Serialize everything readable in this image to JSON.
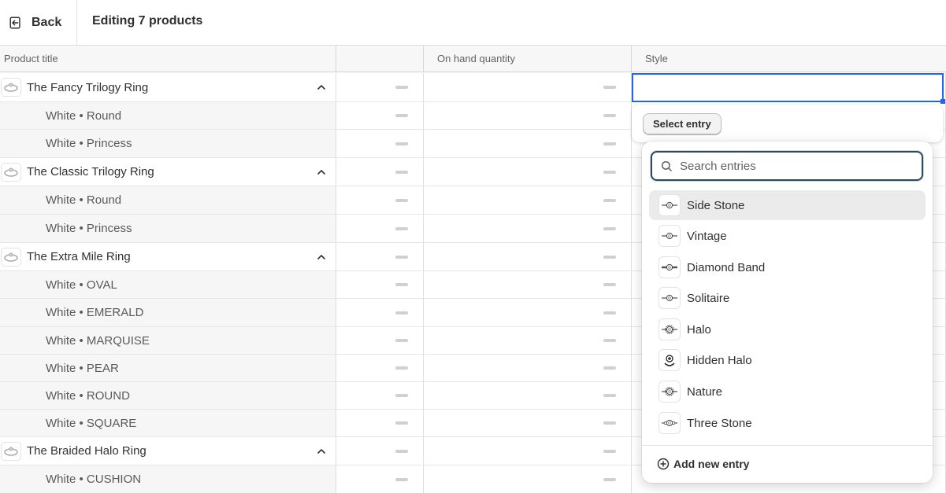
{
  "header": {
    "back_label": "Back",
    "title": "Editing 7 products"
  },
  "columns": [
    "Product title",
    "",
    "On hand quantity",
    "Style"
  ],
  "rows": [
    {
      "type": "product",
      "title": "The Fancy Trilogy Ring"
    },
    {
      "type": "variant",
      "title": "White • Round"
    },
    {
      "type": "variant",
      "title": "White • Princess"
    },
    {
      "type": "product",
      "title": "The Classic Trilogy Ring"
    },
    {
      "type": "variant",
      "title": "White • Round"
    },
    {
      "type": "variant",
      "title": "White • Princess"
    },
    {
      "type": "product",
      "title": "The Extra Mile Ring"
    },
    {
      "type": "variant",
      "title": "White • OVAL"
    },
    {
      "type": "variant",
      "title": "White • EMERALD"
    },
    {
      "type": "variant",
      "title": "White • MARQUISE"
    },
    {
      "type": "variant",
      "title": "White • PEAR"
    },
    {
      "type": "variant",
      "title": "White • ROUND"
    },
    {
      "type": "variant",
      "title": "White • SQUARE"
    },
    {
      "type": "product",
      "title": "The Braided Halo Ring"
    },
    {
      "type": "variant",
      "title": "White • CUSHION"
    }
  ],
  "entry_picker": {
    "select_label": "Select entry",
    "search_placeholder": "Search entries",
    "options": [
      {
        "label": "Side Stone",
        "icon": "side-stone-ring-icon",
        "active": true
      },
      {
        "label": "Vintage",
        "icon": "vintage-ring-icon"
      },
      {
        "label": "Diamond Band",
        "icon": "diamond-band-ring-icon"
      },
      {
        "label": "Solitaire",
        "icon": "solitaire-ring-icon"
      },
      {
        "label": "Halo",
        "icon": "halo-ring-icon"
      },
      {
        "label": "Hidden Halo",
        "icon": "hidden-halo-ring-icon"
      },
      {
        "label": "Nature",
        "icon": "nature-ring-icon"
      },
      {
        "label": "Three Stone",
        "icon": "three-stone-ring-icon"
      }
    ],
    "add_label": "Add new entry"
  },
  "colors": {
    "accent": "#2463eb",
    "search_border": "#2e4a5f",
    "variant_bg": "#f6f6f6"
  }
}
